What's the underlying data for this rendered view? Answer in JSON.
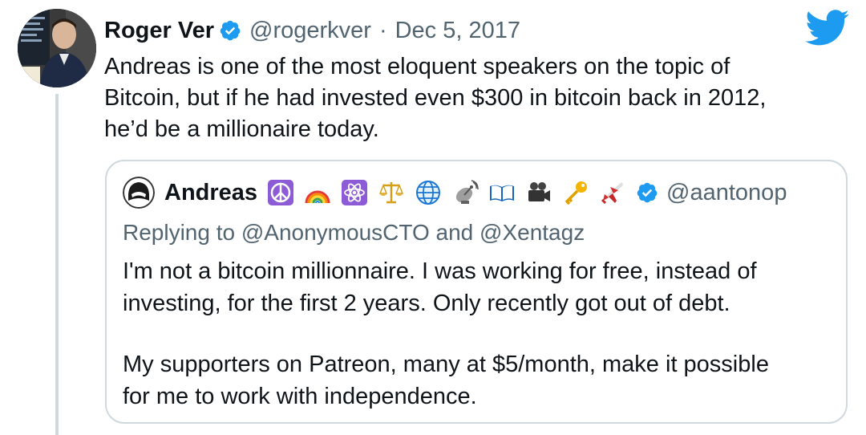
{
  "tweet": {
    "author_name": "Roger Ver",
    "author_handle": "@rogerkver",
    "separator": "·",
    "date": "Dec 5, 2017",
    "text_lines": [
      "Andreas is one of the most eloquent speakers on the topic of",
      "Bitcoin, but if he had invested even $300 in bitcoin back in 2012,",
      "he’d be a millionaire today."
    ]
  },
  "quoted": {
    "author_name": "Andreas",
    "author_handle": "@aantonop",
    "name_emojis": [
      "peace-symbol",
      "rainbow",
      "atom-symbol",
      "balance-scale",
      "globe",
      "satellite-antenna",
      "open-book",
      "video-camera",
      "key",
      "airplane"
    ],
    "replying_to": "Replying to @AnonymousCTO and @Xentagz",
    "paragraph1_lines": [
      "I'm not a bitcoin millionnaire. I was working for free, instead of",
      "investing, for the first 2 years. Only recently got out of debt."
    ],
    "paragraph2_lines": [
      "My supporters on Patreon, many at $5/month, make it possible",
      "for me to work with independence."
    ]
  },
  "colors": {
    "twitter_blue": "#1d9bf0",
    "text_primary": "#0f1419",
    "text_secondary": "#536471",
    "border": "#cfd9de"
  }
}
